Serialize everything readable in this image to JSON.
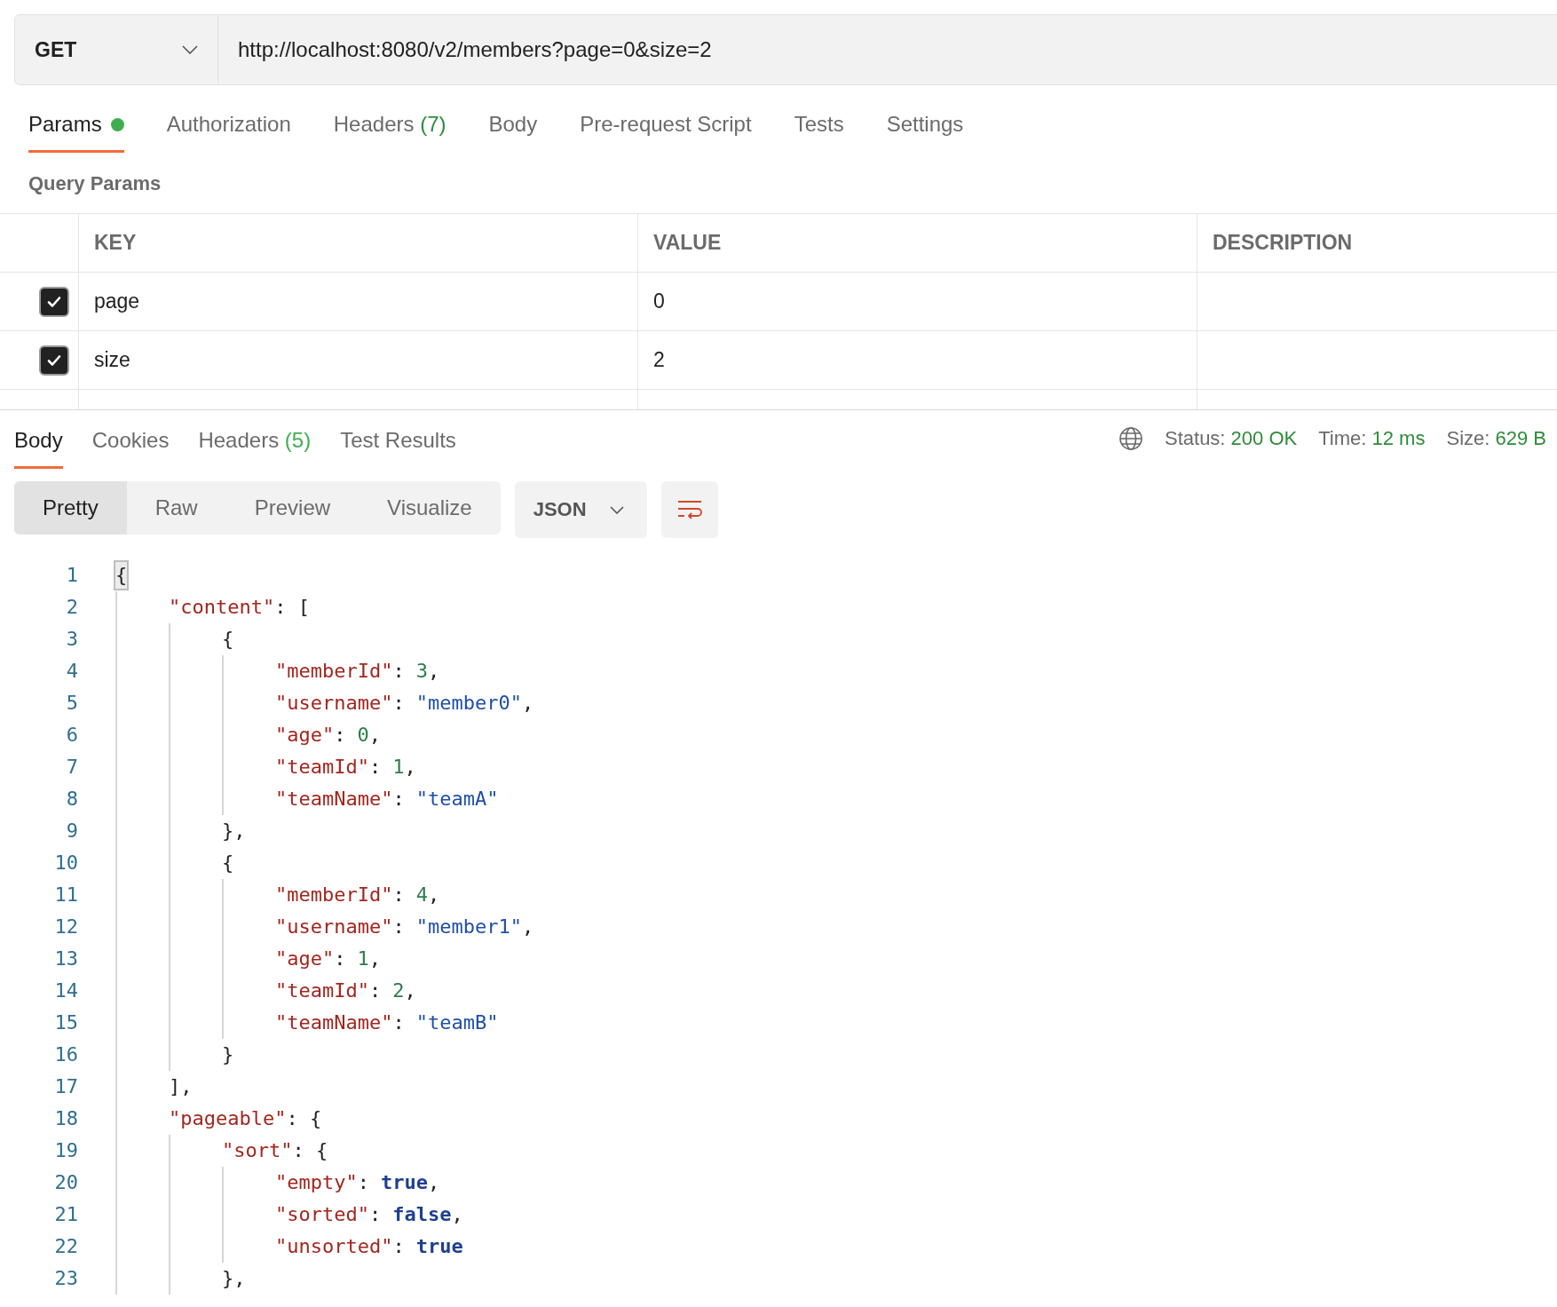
{
  "request": {
    "method": "GET",
    "url": "http://localhost:8080/v2/members?page=0&size=2"
  },
  "request_tabs": [
    {
      "label": "Params",
      "selected": true,
      "dot": true
    },
    {
      "label": "Authorization",
      "selected": false,
      "dot": false
    },
    {
      "label": "Headers",
      "count": "(7)",
      "selected": false,
      "dot": false
    },
    {
      "label": "Body",
      "selected": false,
      "dot": false
    },
    {
      "label": "Pre-request Script",
      "selected": false,
      "dot": false
    },
    {
      "label": "Tests",
      "selected": false,
      "dot": false
    },
    {
      "label": "Settings",
      "selected": false,
      "dot": false
    }
  ],
  "query_params": {
    "title": "Query Params",
    "columns": [
      "KEY",
      "VALUE",
      "DESCRIPTION"
    ],
    "rows": [
      {
        "checked": true,
        "key": "page",
        "value": "0"
      },
      {
        "checked": true,
        "key": "size",
        "value": "2"
      }
    ]
  },
  "response_tabs": [
    {
      "label": "Body",
      "selected": true
    },
    {
      "label": "Cookies",
      "selected": false
    },
    {
      "label": "Headers",
      "count": "(5)",
      "selected": false
    },
    {
      "label": "Test Results",
      "selected": false
    }
  ],
  "status": [
    {
      "label": "Status:",
      "value": "200 OK"
    },
    {
      "label": "Time:",
      "value": "12 ms"
    },
    {
      "label": "Size:",
      "value": "629 B"
    }
  ],
  "view_modes": [
    {
      "label": "Pretty",
      "selected": true
    },
    {
      "label": "Raw",
      "selected": false
    },
    {
      "label": "Preview",
      "selected": false
    },
    {
      "label": "Visualize",
      "selected": false
    }
  ],
  "format": "JSON",
  "code_lines": [
    {
      "number": "1",
      "tokens": [
        {
          "kind": "punct",
          "text": "{",
          "highlighted": true
        }
      ],
      "children": [
        {
          "number": "2",
          "tokens": [
            {
              "kind": "key",
              "text": "\"content\""
            },
            {
              "kind": "punct",
              "text": ": ["
            }
          ],
          "children": [
            {
              "number": "3",
              "tokens": [
                {
                  "kind": "punct",
                  "text": "{"
                }
              ],
              "children": [
                {
                  "number": "4",
                  "tokens": [
                    {
                      "kind": "key",
                      "text": "\"memberId\""
                    },
                    {
                      "kind": "punct",
                      "text": ":"
                    },
                    {
                      "kind": "number",
                      "text": "3"
                    },
                    {
                      "kind": "punct",
                      "text": ","
                    }
                  ]
                },
                {
                  "number": "5",
                  "tokens": [
                    {
                      "kind": "key",
                      "text": "\"username\""
                    },
                    {
                      "kind": "punct",
                      "text": ":"
                    },
                    {
                      "kind": "string",
                      "text": "\"member0\""
                    },
                    {
                      "kind": "punct",
                      "text": ","
                    }
                  ]
                },
                {
                  "number": "6",
                  "tokens": [
                    {
                      "kind": "key",
                      "text": "\"age\""
                    },
                    {
                      "kind": "punct",
                      "text": ":"
                    },
                    {
                      "kind": "number",
                      "text": "0"
                    },
                    {
                      "kind": "punct",
                      "text": ","
                    }
                  ]
                },
                {
                  "number": "7",
                  "tokens": [
                    {
                      "kind": "key",
                      "text": "\"teamId\""
                    },
                    {
                      "kind": "punct",
                      "text": ":"
                    },
                    {
                      "kind": "number",
                      "text": "1"
                    },
                    {
                      "kind": "punct",
                      "text": ","
                    }
                  ]
                },
                {
                  "number": "8",
                  "tokens": [
                    {
                      "kind": "key",
                      "text": "\"teamName\""
                    },
                    {
                      "kind": "punct",
                      "text": ":"
                    },
                    {
                      "kind": "string",
                      "text": "\"teamA\""
                    }
                  ]
                }
              ]
            },
            {
              "number": "9",
              "tokens": [
                {
                  "kind": "punct",
                  "text": "},"
                }
              ]
            },
            {
              "number": "10",
              "tokens": [
                {
                  "kind": "punct",
                  "text": "{"
                }
              ],
              "children": [
                {
                  "number": "11",
                  "tokens": [
                    {
                      "kind": "key",
                      "text": "\"memberId\""
                    },
                    {
                      "kind": "punct",
                      "text": ":"
                    },
                    {
                      "kind": "number",
                      "text": "4"
                    },
                    {
                      "kind": "punct",
                      "text": ","
                    }
                  ]
                },
                {
                  "number": "12",
                  "tokens": [
                    {
                      "kind": "key",
                      "text": "\"username\""
                    },
                    {
                      "kind": "punct",
                      "text": ":"
                    },
                    {
                      "kind": "string",
                      "text": "\"member1\""
                    },
                    {
                      "kind": "punct",
                      "text": ","
                    }
                  ]
                },
                {
                  "number": "13",
                  "tokens": [
                    {
                      "kind": "key",
                      "text": "\"age\""
                    },
                    {
                      "kind": "punct",
                      "text": ":"
                    },
                    {
                      "kind": "number",
                      "text": "1"
                    },
                    {
                      "kind": "punct",
                      "text": ","
                    }
                  ]
                },
                {
                  "number": "14",
                  "tokens": [
                    {
                      "kind": "key",
                      "text": "\"teamId\""
                    },
                    {
                      "kind": "punct",
                      "text": ":"
                    },
                    {
                      "kind": "number",
                      "text": "2"
                    },
                    {
                      "kind": "punct",
                      "text": ","
                    }
                  ]
                },
                {
                  "number": "15",
                  "tokens": [
                    {
                      "kind": "key",
                      "text": "\"teamName\""
                    },
                    {
                      "kind": "punct",
                      "text": ":"
                    },
                    {
                      "kind": "string",
                      "text": "\"teamB\""
                    }
                  ]
                }
              ]
            },
            {
              "number": "16",
              "tokens": [
                {
                  "kind": "punct",
                  "text": "}"
                }
              ]
            }
          ]
        },
        {
          "number": "17",
          "tokens": [
            {
              "kind": "punct",
              "text": "],"
            }
          ]
        },
        {
          "number": "18",
          "tokens": [
            {
              "kind": "key",
              "text": "\"pageable\""
            },
            {
              "kind": "punct",
              "text": ": {"
            }
          ],
          "children": [
            {
              "number": "19",
              "tokens": [
                {
                  "kind": "key",
                  "text": "\"sort\""
                },
                {
                  "kind": "punct",
                  "text": ": {"
                }
              ],
              "children": [
                {
                  "number": "20",
                  "tokens": [
                    {
                      "kind": "key",
                      "text": "\"empty\""
                    },
                    {
                      "kind": "punct",
                      "text": ":"
                    },
                    {
                      "kind": "bool",
                      "text": "true"
                    },
                    {
                      "kind": "punct",
                      "text": ","
                    }
                  ]
                },
                {
                  "number": "21",
                  "tokens": [
                    {
                      "kind": "key",
                      "text": "\"sorted\""
                    },
                    {
                      "kind": "punct",
                      "text": ":"
                    },
                    {
                      "kind": "bool",
                      "text": "false"
                    },
                    {
                      "kind": "punct",
                      "text": ","
                    }
                  ]
                },
                {
                  "number": "22",
                  "tokens": [
                    {
                      "kind": "key",
                      "text": "\"unsorted\""
                    },
                    {
                      "kind": "punct",
                      "text": ":"
                    },
                    {
                      "kind": "bool",
                      "text": "true"
                    }
                  ]
                }
              ]
            },
            {
              "number": "23",
              "tokens": [
                {
                  "kind": "punct",
                  "text": "},"
                }
              ]
            }
          ]
        }
      ]
    }
  ]
}
